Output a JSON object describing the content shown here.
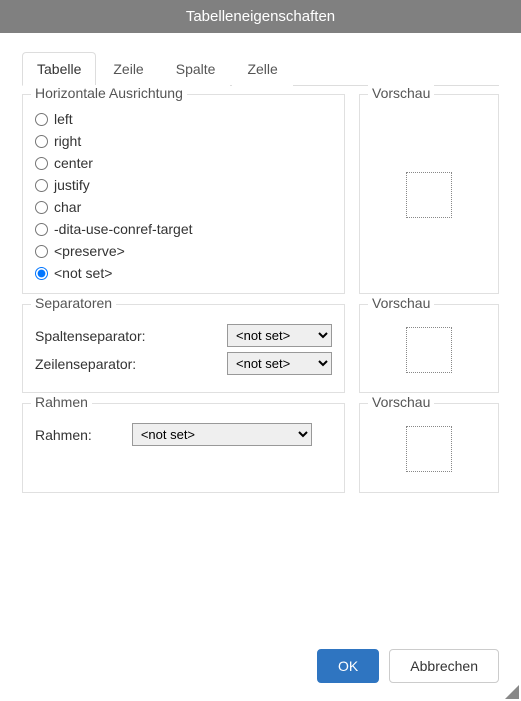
{
  "header": {
    "title": "Tabelleneigenschaften"
  },
  "tabs": [
    {
      "label": "Tabelle"
    },
    {
      "label": "Zeile"
    },
    {
      "label": "Spalte"
    },
    {
      "label": "Zelle"
    }
  ],
  "alignment": {
    "legend": "Horizontale Ausrichtung",
    "options": {
      "o0": "left",
      "o1": "right",
      "o2": "center",
      "o3": "justify",
      "o4": "char",
      "o5": "-dita-use-conref-target",
      "o6": "<preserve>",
      "o7": "<not set>"
    },
    "preview_legend": "Vorschau"
  },
  "separators": {
    "legend": "Separatoren",
    "col_label": "Spaltenseparator:",
    "row_label": "Zeilenseparator:",
    "col_value": "<not set>",
    "row_value": "<not set>",
    "preview_legend": "Vorschau"
  },
  "frame": {
    "legend": "Rahmen",
    "label": "Rahmen:",
    "value": "<not set>",
    "preview_legend": "Vorschau"
  },
  "footer": {
    "ok": "OK",
    "cancel": "Abbrechen"
  }
}
